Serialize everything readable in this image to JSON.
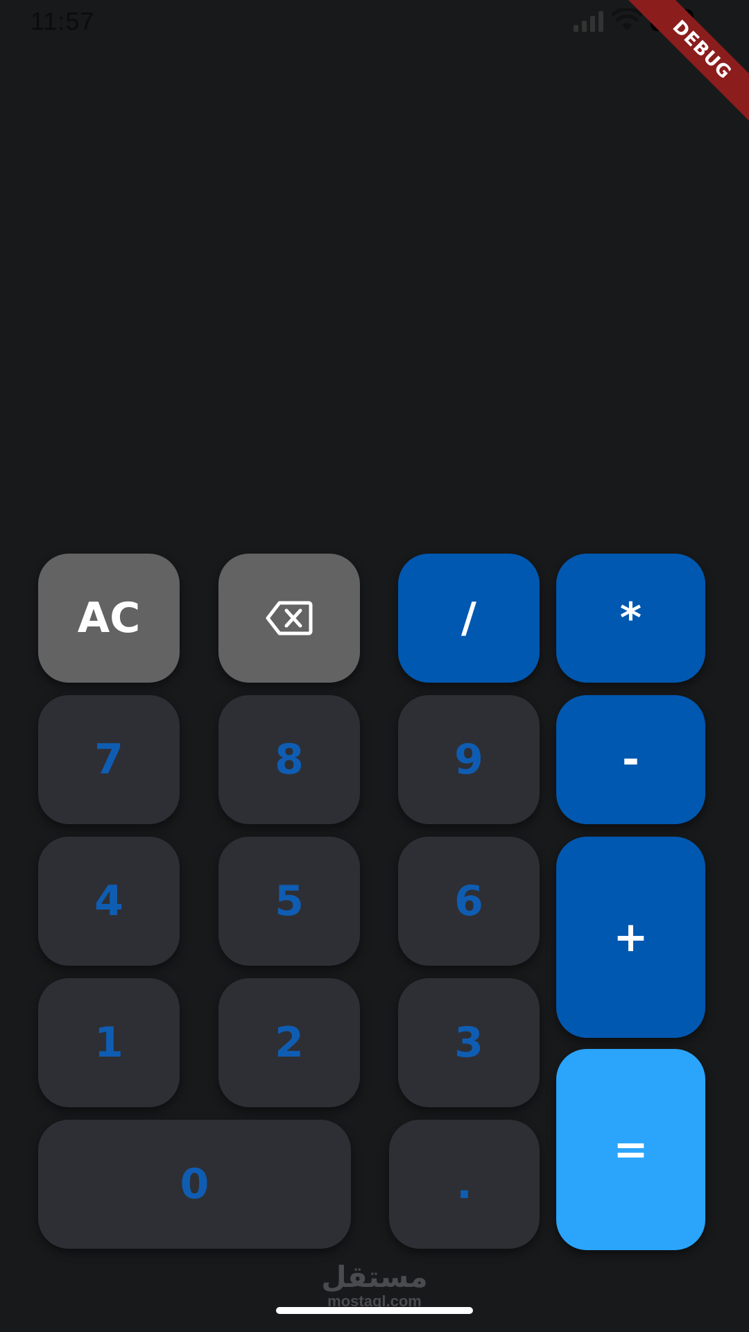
{
  "status_bar": {
    "time": "11:57",
    "signal_icon": "cellular-signal-icon",
    "wifi_icon": "wifi-icon",
    "battery_icon": "battery-icon"
  },
  "debug_banner": {
    "label": "DEBUG"
  },
  "display": {
    "expression": "",
    "result": ""
  },
  "keypad": {
    "clear": "AC",
    "backspace_icon": "backspace-icon",
    "divide": "/",
    "multiply": "*",
    "seven": "7",
    "eight": "8",
    "nine": "9",
    "minus": "-",
    "four": "4",
    "five": "5",
    "six": "6",
    "plus": "+",
    "one": "1",
    "two": "2",
    "three": "3",
    "zero": "0",
    "dot": ".",
    "equals": "="
  },
  "watermark": {
    "arabic": "مستقل",
    "latin": "mostaql.com"
  },
  "colors": {
    "background": "#18191b",
    "number_key": "#2e2f34",
    "number_text": "#0f5db3",
    "utility_key": "#636363",
    "operator_key": "#0058b0",
    "equals_key": "#2aa5fb",
    "debug_banner": "#8b1d1d"
  }
}
